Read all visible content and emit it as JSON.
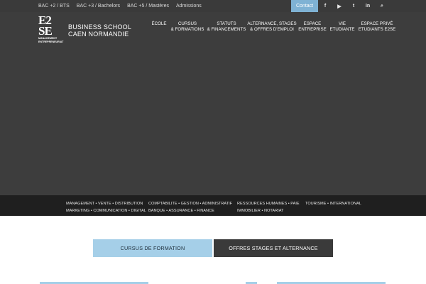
{
  "topbar": {
    "links": [
      "BAC +2 / BTS",
      "BAC +3 / Bachelors",
      "BAC +5 / Mastères",
      "Admissions"
    ],
    "contact": "Contact",
    "social": [
      {
        "icon": "facebook-icon",
        "glyph": "f"
      },
      {
        "icon": "youtube-icon",
        "glyph": "▶"
      },
      {
        "icon": "twitter-icon",
        "glyph": "t"
      },
      {
        "icon": "linkedin-icon",
        "glyph": "in"
      },
      {
        "icon": "search-icon",
        "glyph": "⌕"
      }
    ]
  },
  "header": {
    "logo_mark_line1": "E2",
    "logo_mark_line2": "SE",
    "logo_sub_line1": "MANAGEMENT",
    "logo_sub_line2": "ENTREPRENEURIAT",
    "brand_line1": "BUSINESS SCHOOL",
    "brand_line2": "CAEN NORMANDIE",
    "nav": [
      {
        "line1": "ÉCOLE",
        "line2": ""
      },
      {
        "line1": "CURSUS",
        "line2": "& FORMATIONS"
      },
      {
        "line1": "STATUTS",
        "line2": "& FINANCEMENTS"
      },
      {
        "line1": "ALTERNANCE, STAGES",
        "line2": "& OFFRES D'EMPLOI"
      },
      {
        "line1": "ESPACE",
        "line2": "ENTREPRISE"
      },
      {
        "line1": "VIE",
        "line2": "ETUDIANTE"
      },
      {
        "line1": "ESPACE PRIVÉ",
        "line2": "ETUDIANTS E2SE"
      }
    ]
  },
  "categories": [
    {
      "line1": "MANAGEMENT • VENTE • DISTRIBUTION",
      "line2": "MARKETING • COMMUNICATION • DIGITAL"
    },
    {
      "line1": "COMPTABILITE • GESTION • ADMINISTRATIF",
      "line2": "BANQUE • ASSURANCE • FINANCE"
    },
    {
      "line1": "RESSOURCES HUMAINES • PAIE",
      "line2": "IMMOBILIER • NOTARIAT"
    },
    {
      "line1": "TOURISME • INTERNATIONAL",
      "line2": ""
    }
  ],
  "main": {
    "btn_cursus": "CURSUS DE FORMATION",
    "btn_offres": "OFFRES STAGES ET ALTERNANCE"
  },
  "colors": {
    "accent": "#7fb2d4",
    "light_blue": "#a5cfe8",
    "hero_bg": "#3d3d3d",
    "topbar_bg": "#3a3a3a",
    "strip_bg": "#1f1f1f"
  }
}
